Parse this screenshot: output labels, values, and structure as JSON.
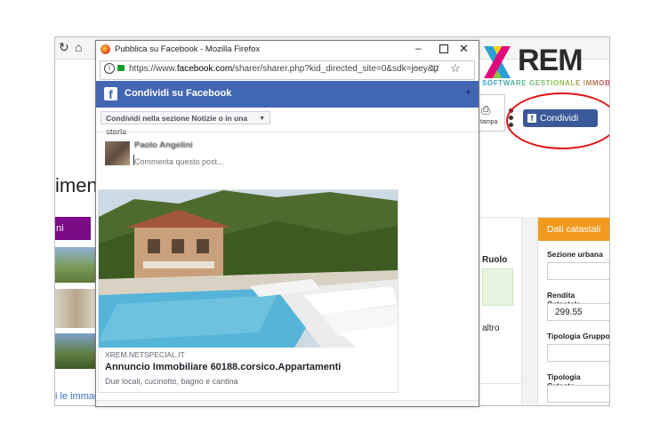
{
  "colors": {
    "facebook_blue": "#4267b2",
    "share_button_blue": "#3b5998",
    "annotation_red": "#e01212",
    "panel_orange": "#f39a1e",
    "purple_bar": "#7a0a85"
  },
  "background_app": {
    "toolbar_icons": [
      "reload-icon",
      "home-icon"
    ],
    "heading_fragment": "imento",
    "purple_bar_text": "ni",
    "link_fragment": "i le immagini",
    "mid_panel": {
      "label": "Ruolo",
      "option": "altro"
    },
    "print_button_label": "tampa",
    "share_button_label": "Condividi",
    "logo": {
      "wordmark": "REM",
      "tagline": "SOFTWARE GESTIONALE IMMOBILIARE"
    },
    "dati_catastali": {
      "title": "Dati catastali",
      "fields": [
        {
          "label": "Sezione urbana",
          "value": ""
        },
        {
          "label": "Rendita Catastale",
          "value": "299.55"
        },
        {
          "label": "Tipologia Gruppo",
          "value": ""
        },
        {
          "label": "Tipologia Catasto",
          "value": ""
        }
      ]
    }
  },
  "popup": {
    "window_title": "Pubblica su Facebook - Mozilla Firefox",
    "url_prefix": "https://www.",
    "url_domain": "facebook.com",
    "url_rest": "/sharer/sharer.php?kid_directed_site=0&sdk=joey&u",
    "url_overflow_icon": "···",
    "facebook": {
      "header_title": "Condividi su Facebook",
      "share_target": "Condividi nella sezione Notizie o in una storia",
      "user_name": "Paolo Angelini",
      "comment_placeholder": "Commenta questo post...",
      "link_preview": {
        "domain": "XREM.NETSPECIAL.IT",
        "title": "Annuncio Immobiliare 60188.corsico.Appartamenti",
        "description": "Due locali, cucinotto, bagno e cantina"
      }
    }
  }
}
